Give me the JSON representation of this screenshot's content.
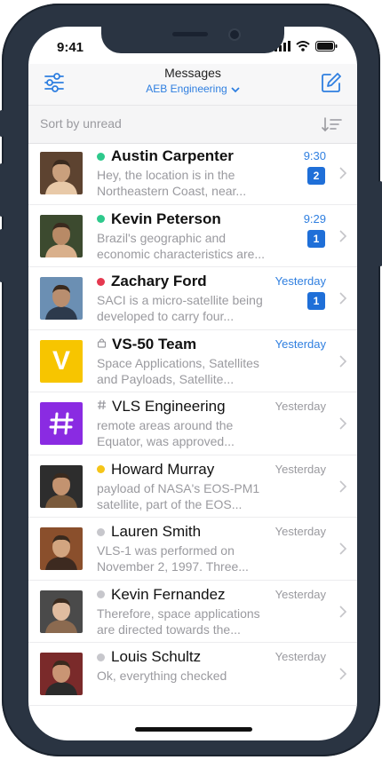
{
  "status_bar": {
    "time": "9:41"
  },
  "nav": {
    "title": "Messages",
    "workspace": "AEB Engineering"
  },
  "sort": {
    "label": "Sort by unread"
  },
  "colors": {
    "accent": "#2f7fe0",
    "badge": "#1f6fd8",
    "online": "#2ec98c",
    "busy": "#e53950",
    "away": "#f5c518",
    "offline": "#c7c7cc"
  },
  "conversations": [
    {
      "name": "Austin Carpenter",
      "status": "online",
      "time": "9:30",
      "time_highlight": true,
      "preview": "Hey, the location is in the Northeastern Coast, near...",
      "unread": "2",
      "bold": true,
      "avatar": "photo-avatar"
    },
    {
      "name": "Kevin Peterson",
      "status": "online",
      "time": "9:29",
      "time_highlight": true,
      "preview": "Brazil's geographic and economic characteristics are...",
      "unread": "1",
      "bold": true,
      "avatar": "photo-avatar"
    },
    {
      "name": "Zachary Ford",
      "status": "busy",
      "time": "Yesterday",
      "time_highlight": true,
      "preview": "SACI is a micro-satellite being developed to carry four...",
      "unread": "1",
      "bold": true,
      "avatar": "photo-avatar"
    },
    {
      "name": "VS-50 Team",
      "status": "lock",
      "time": "Yesterday",
      "time_highlight": true,
      "preview": "Space Applications, Satellites and Payloads, Satellite...",
      "unread": "",
      "bold": true,
      "avatar": "letter-avatar",
      "avatar_letter": "V"
    },
    {
      "name": "VLS Engineering",
      "status": "hash",
      "time": "Yesterday",
      "time_highlight": false,
      "preview": "remote areas around the Equator, was approved...",
      "unread": "",
      "bold": false,
      "avatar": "hash-avatar"
    },
    {
      "name": "Howard Murray",
      "status": "away",
      "time": "Yesterday",
      "time_highlight": false,
      "preview": "payload of NASA's EOS-PM1 satellite, part of the EOS...",
      "unread": "",
      "bold": false,
      "avatar": "photo-avatar"
    },
    {
      "name": "Lauren Smith",
      "status": "offline",
      "time": "Yesterday",
      "time_highlight": false,
      "preview": "VLS-1 was performed on November 2, 1997. Three...",
      "unread": "",
      "bold": false,
      "avatar": "photo-avatar"
    },
    {
      "name": "Kevin Fernandez",
      "status": "offline",
      "time": "Yesterday",
      "time_highlight": false,
      "preview": "Therefore, space applications are directed towards the...",
      "unread": "",
      "bold": false,
      "avatar": "photo-avatar"
    },
    {
      "name": "Louis Schultz",
      "status": "offline",
      "time": "Yesterday",
      "time_highlight": false,
      "preview": "Ok, everything checked",
      "unread": "",
      "bold": false,
      "avatar": "photo-avatar"
    }
  ]
}
